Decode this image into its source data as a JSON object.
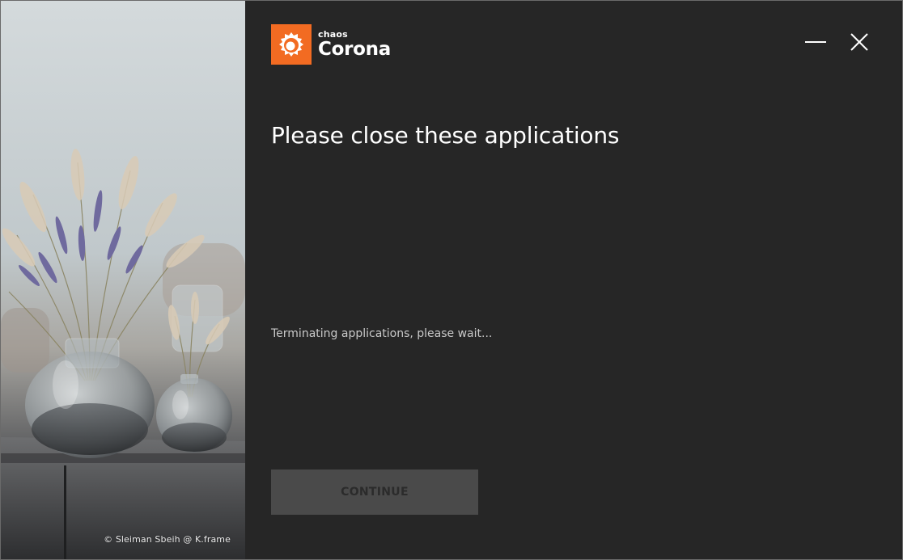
{
  "window": {
    "background_color": "#262626"
  },
  "left_panel": {
    "image": "vases-with-dried-flowers",
    "credit": "© Sleiman Sbeih @ K.frame"
  },
  "logo": {
    "icon": "corona-flame-logo-icon",
    "brand": "chaos",
    "product": "Corona",
    "accent_color": "#f26b22"
  },
  "window_controls": {
    "minimize_icon": "minimize-icon",
    "close_icon": "close-icon"
  },
  "main": {
    "title": "Please close these applications",
    "status_text": "Terminating applications, please wait...",
    "continue_label": "CONTINUE",
    "continue_enabled": false
  }
}
